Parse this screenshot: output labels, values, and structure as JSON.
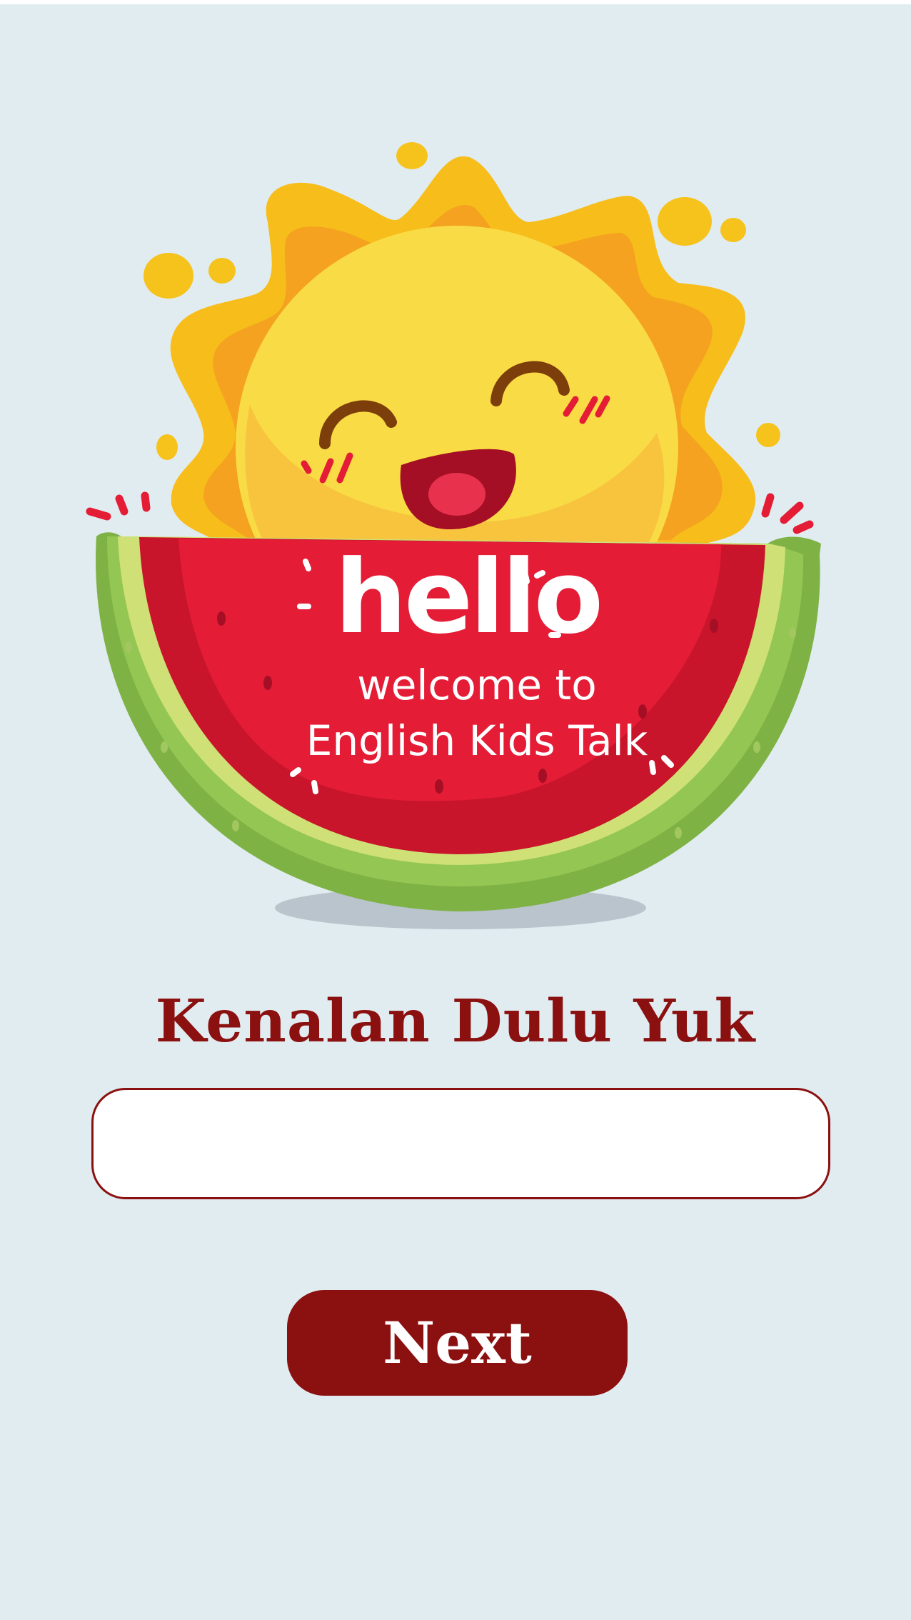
{
  "banner": {
    "greeting": "hello",
    "welcome_line1": "welcome to",
    "welcome_line2": "English Kids Talk"
  },
  "form": {
    "heading": "Kenalan Dulu Yuk",
    "name_value": "",
    "name_placeholder": "",
    "next_label": "Next"
  },
  "colors": {
    "background": "#e1ecf1",
    "accent": "#8b1010",
    "sun": "#f9dc45",
    "watermelon": "#e41c36",
    "rind": "#8ec44d"
  },
  "icons": {
    "mascot": "sun-in-watermelon-illustration"
  }
}
